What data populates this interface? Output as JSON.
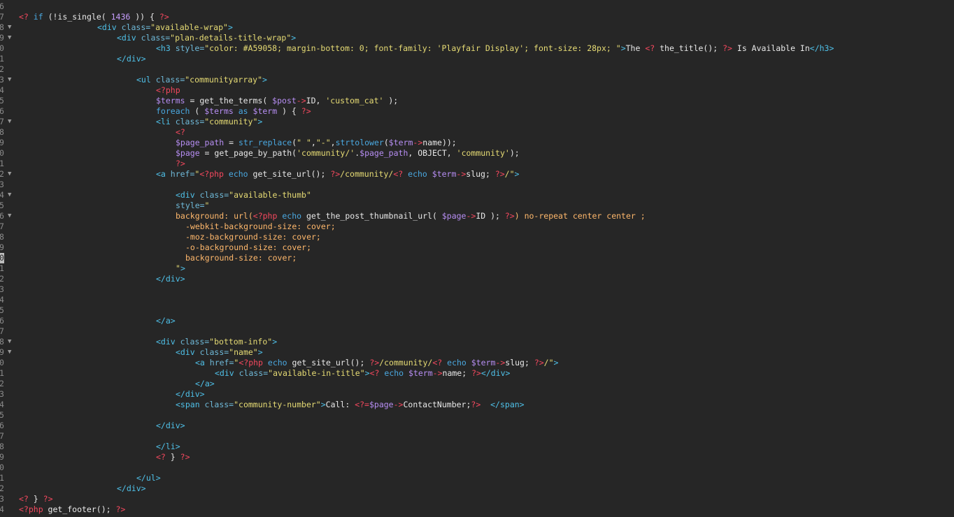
{
  "editor": {
    "active_line_index": 24,
    "lines": [
      {
        "n": "6",
        "fold": false,
        "indent": 0,
        "tokens": []
      },
      {
        "n": "7",
        "fold": false,
        "indent": 0,
        "tokens": [
          [
            "php",
            "<?"
          ],
          [
            "p",
            " "
          ],
          [
            "kw",
            "if"
          ],
          [
            "p",
            " (!is_single( "
          ],
          [
            "num",
            "1436"
          ],
          [
            "p",
            " )) { "
          ],
          [
            "php",
            "?>"
          ]
        ]
      },
      {
        "n": "8",
        "fold": true,
        "indent": 16,
        "tokens": [
          [
            "tag",
            "<div"
          ],
          [
            "attr",
            " class="
          ],
          [
            "str",
            "\"available-wrap\""
          ],
          [
            "tag",
            ">"
          ]
        ]
      },
      {
        "n": "9",
        "fold": true,
        "indent": 20,
        "tokens": [
          [
            "tag",
            "<div"
          ],
          [
            "attr",
            " class="
          ],
          [
            "str",
            "\"plan-details-title-wrap\""
          ],
          [
            "tag",
            ">"
          ]
        ]
      },
      {
        "n": "0",
        "fold": false,
        "indent": 28,
        "tokens": [
          [
            "tag",
            "<h3"
          ],
          [
            "attr",
            " style="
          ],
          [
            "str",
            "\"color: #A59058; margin-bottom: 0; font-family: 'Playfair Display'; font-size: 28px; \""
          ],
          [
            "tag",
            ">"
          ],
          [
            "p",
            "The "
          ],
          [
            "php",
            "<?"
          ],
          [
            "p",
            " the_title(); "
          ],
          [
            "php",
            "?>"
          ],
          [
            "p",
            " Is Available In"
          ],
          [
            "tag",
            "</h3>"
          ]
        ]
      },
      {
        "n": "1",
        "fold": false,
        "indent": 20,
        "tokens": [
          [
            "tag",
            "</div>"
          ]
        ]
      },
      {
        "n": "2",
        "fold": false,
        "indent": 0,
        "tokens": []
      },
      {
        "n": "3",
        "fold": true,
        "indent": 24,
        "tokens": [
          [
            "tag",
            "<ul"
          ],
          [
            "attr",
            " class="
          ],
          [
            "str",
            "\"communityarray\""
          ],
          [
            "tag",
            ">"
          ]
        ]
      },
      {
        "n": "4",
        "fold": false,
        "indent": 28,
        "tokens": [
          [
            "php",
            "<?php"
          ]
        ]
      },
      {
        "n": "5",
        "fold": false,
        "indent": 28,
        "tokens": [
          [
            "var",
            "$terms"
          ],
          [
            "p",
            " = get_the_terms( "
          ],
          [
            "var",
            "$post"
          ],
          [
            "php",
            "->"
          ],
          [
            "p",
            "ID, "
          ],
          [
            "str",
            "'custom_cat'"
          ],
          [
            "p",
            " );"
          ]
        ]
      },
      {
        "n": "6",
        "fold": false,
        "indent": 28,
        "tokens": [
          [
            "kw",
            "foreach"
          ],
          [
            "p",
            " ( "
          ],
          [
            "var",
            "$terms"
          ],
          [
            "p",
            " "
          ],
          [
            "kw",
            "as"
          ],
          [
            "p",
            " "
          ],
          [
            "var",
            "$term"
          ],
          [
            "p",
            " ) { "
          ],
          [
            "php",
            "?>"
          ]
        ]
      },
      {
        "n": "7",
        "fold": true,
        "indent": 28,
        "tokens": [
          [
            "tag",
            "<li"
          ],
          [
            "attr",
            " class="
          ],
          [
            "str",
            "\"community\""
          ],
          [
            "tag",
            ">"
          ]
        ]
      },
      {
        "n": "8",
        "fold": false,
        "indent": 32,
        "tokens": [
          [
            "php",
            "<?"
          ]
        ]
      },
      {
        "n": "9",
        "fold": false,
        "indent": 32,
        "tokens": [
          [
            "var",
            "$page_path"
          ],
          [
            "p",
            " = "
          ],
          [
            "kw",
            "str_replace"
          ],
          [
            "p",
            "("
          ],
          [
            "str",
            "\" \""
          ],
          [
            "p",
            ","
          ],
          [
            "str",
            "\"-\""
          ],
          [
            "p",
            ","
          ],
          [
            "kw",
            "strtolower"
          ],
          [
            "p",
            "("
          ],
          [
            "var",
            "$term"
          ],
          [
            "php",
            "->"
          ],
          [
            "p",
            "name));"
          ]
        ]
      },
      {
        "n": "0",
        "fold": false,
        "indent": 32,
        "tokens": [
          [
            "var",
            "$page"
          ],
          [
            "p",
            " = get_page_by_path("
          ],
          [
            "str",
            "'community/'"
          ],
          [
            "p",
            "."
          ],
          [
            "var",
            "$page_path"
          ],
          [
            "p",
            ", OBJECT, "
          ],
          [
            "str",
            "'community'"
          ],
          [
            "p",
            ");"
          ]
        ]
      },
      {
        "n": "1",
        "fold": false,
        "indent": 32,
        "tokens": [
          [
            "php",
            "?>"
          ]
        ]
      },
      {
        "n": "2",
        "fold": true,
        "indent": 28,
        "tokens": [
          [
            "tag",
            "<a"
          ],
          [
            "attr",
            " href="
          ],
          [
            "str",
            "\""
          ],
          [
            "php",
            "<?php"
          ],
          [
            "p",
            " "
          ],
          [
            "kw",
            "echo"
          ],
          [
            "p",
            " get_site_url(); "
          ],
          [
            "php",
            "?>"
          ],
          [
            "str",
            "/community/"
          ],
          [
            "php",
            "<?"
          ],
          [
            "p",
            " "
          ],
          [
            "kw",
            "echo"
          ],
          [
            "p",
            " "
          ],
          [
            "var",
            "$term"
          ],
          [
            "php",
            "->"
          ],
          [
            "p",
            "slug; "
          ],
          [
            "php",
            "?>"
          ],
          [
            "str",
            "/\""
          ],
          [
            "tag",
            ">"
          ]
        ]
      },
      {
        "n": "3",
        "fold": false,
        "indent": 0,
        "tokens": []
      },
      {
        "n": "4",
        "fold": true,
        "indent": 32,
        "tokens": [
          [
            "tag",
            "<div"
          ],
          [
            "attr",
            " class="
          ],
          [
            "str",
            "\"available-thumb\""
          ]
        ]
      },
      {
        "n": "5",
        "fold": false,
        "indent": 32,
        "tokens": [
          [
            "attr",
            "style="
          ],
          [
            "str",
            "\""
          ]
        ]
      },
      {
        "n": "6",
        "fold": true,
        "indent": 32,
        "tokens": [
          [
            "css",
            "background: url("
          ],
          [
            "php",
            "<?php"
          ],
          [
            "p",
            " "
          ],
          [
            "kw",
            "echo"
          ],
          [
            "p",
            " get_the_post_thumbnail_url( "
          ],
          [
            "var",
            "$page"
          ],
          [
            "php",
            "->"
          ],
          [
            "p",
            "ID ); "
          ],
          [
            "php",
            "?>"
          ],
          [
            "css",
            ") no-repeat center center ;"
          ]
        ]
      },
      {
        "n": "7",
        "fold": false,
        "indent": 34,
        "tokens": [
          [
            "css",
            "-webkit-background-size: cover;"
          ]
        ]
      },
      {
        "n": "8",
        "fold": false,
        "indent": 34,
        "tokens": [
          [
            "css",
            "-moz-background-size: cover;"
          ]
        ]
      },
      {
        "n": "9",
        "fold": false,
        "indent": 34,
        "tokens": [
          [
            "css",
            "-o-background-size: cover;"
          ]
        ]
      },
      {
        "n": "0",
        "fold": false,
        "indent": 34,
        "tokens": [
          [
            "css",
            "background-size: cover;"
          ]
        ]
      },
      {
        "n": "1",
        "fold": false,
        "indent": 32,
        "tokens": [
          [
            "str",
            "\""
          ],
          [
            "tag",
            ">"
          ]
        ]
      },
      {
        "n": "2",
        "fold": false,
        "indent": 28,
        "tokens": [
          [
            "tag",
            "</div>"
          ]
        ]
      },
      {
        "n": "3",
        "fold": false,
        "indent": 0,
        "tokens": []
      },
      {
        "n": "4",
        "fold": false,
        "indent": 0,
        "tokens": []
      },
      {
        "n": "5",
        "fold": false,
        "indent": 0,
        "tokens": []
      },
      {
        "n": "6",
        "fold": false,
        "indent": 28,
        "tokens": [
          [
            "tag",
            "</a>"
          ]
        ]
      },
      {
        "n": "7",
        "fold": false,
        "indent": 0,
        "tokens": []
      },
      {
        "n": "8",
        "fold": true,
        "indent": 28,
        "tokens": [
          [
            "tag",
            "<div"
          ],
          [
            "attr",
            " class="
          ],
          [
            "str",
            "\"bottom-info\""
          ],
          [
            "tag",
            ">"
          ]
        ]
      },
      {
        "n": "9",
        "fold": true,
        "indent": 32,
        "tokens": [
          [
            "tag",
            "<div"
          ],
          [
            "attr",
            " class="
          ],
          [
            "str",
            "\"name\""
          ],
          [
            "tag",
            ">"
          ]
        ]
      },
      {
        "n": "0",
        "fold": false,
        "indent": 36,
        "tokens": [
          [
            "tag",
            "<a"
          ],
          [
            "attr",
            " href="
          ],
          [
            "str",
            "\""
          ],
          [
            "php",
            "<?php"
          ],
          [
            "p",
            " "
          ],
          [
            "kw",
            "echo"
          ],
          [
            "p",
            " get_site_url(); "
          ],
          [
            "php",
            "?>"
          ],
          [
            "str",
            "/community/"
          ],
          [
            "php",
            "<?"
          ],
          [
            "p",
            " "
          ],
          [
            "kw",
            "echo"
          ],
          [
            "p",
            " "
          ],
          [
            "var",
            "$term"
          ],
          [
            "php",
            "->"
          ],
          [
            "p",
            "slug; "
          ],
          [
            "php",
            "?>"
          ],
          [
            "str",
            "/\""
          ],
          [
            "tag",
            ">"
          ]
        ]
      },
      {
        "n": "1",
        "fold": false,
        "indent": 40,
        "tokens": [
          [
            "tag",
            "<div"
          ],
          [
            "attr",
            " class="
          ],
          [
            "str",
            "\"available-in-title\""
          ],
          [
            "tag",
            ">"
          ],
          [
            "php",
            "<?"
          ],
          [
            "p",
            " "
          ],
          [
            "kw",
            "echo"
          ],
          [
            "p",
            " "
          ],
          [
            "var",
            "$term"
          ],
          [
            "php",
            "->"
          ],
          [
            "p",
            "name; "
          ],
          [
            "php",
            "?>"
          ],
          [
            "tag",
            "</div>"
          ]
        ]
      },
      {
        "n": "2",
        "fold": false,
        "indent": 36,
        "tokens": [
          [
            "tag",
            "</a>"
          ]
        ]
      },
      {
        "n": "3",
        "fold": false,
        "indent": 32,
        "tokens": [
          [
            "tag",
            "</div>"
          ]
        ]
      },
      {
        "n": "4",
        "fold": false,
        "indent": 32,
        "tokens": [
          [
            "tag",
            "<span"
          ],
          [
            "attr",
            " class="
          ],
          [
            "str",
            "\"community-number\""
          ],
          [
            "tag",
            ">"
          ],
          [
            "p",
            "Call: "
          ],
          [
            "php",
            "<?="
          ],
          [
            "var",
            "$page"
          ],
          [
            "php",
            "->"
          ],
          [
            "p",
            "ContactNumber;"
          ],
          [
            "php",
            "?>"
          ],
          [
            "p",
            "  "
          ],
          [
            "tag",
            "</span>"
          ]
        ]
      },
      {
        "n": "5",
        "fold": false,
        "indent": 0,
        "tokens": []
      },
      {
        "n": "6",
        "fold": false,
        "indent": 28,
        "tokens": [
          [
            "tag",
            "</div>"
          ]
        ]
      },
      {
        "n": "7",
        "fold": false,
        "indent": 0,
        "tokens": []
      },
      {
        "n": "8",
        "fold": false,
        "indent": 28,
        "tokens": [
          [
            "tag",
            "</li>"
          ]
        ]
      },
      {
        "n": "9",
        "fold": false,
        "indent": 28,
        "tokens": [
          [
            "php",
            "<?"
          ],
          [
            "p",
            " } "
          ],
          [
            "php",
            "?>"
          ]
        ]
      },
      {
        "n": "0",
        "fold": false,
        "indent": 0,
        "tokens": []
      },
      {
        "n": "1",
        "fold": false,
        "indent": 24,
        "tokens": [
          [
            "tag",
            "</ul>"
          ]
        ]
      },
      {
        "n": "2",
        "fold": false,
        "indent": 20,
        "tokens": [
          [
            "tag",
            "</div>"
          ]
        ]
      },
      {
        "n": "3",
        "fold": false,
        "indent": 0,
        "tokens": [
          [
            "php",
            "<?"
          ],
          [
            "p",
            " } "
          ],
          [
            "php",
            "?>"
          ]
        ]
      },
      {
        "n": "4",
        "fold": false,
        "indent": 0,
        "tokens": [
          [
            "php",
            "<?php"
          ],
          [
            "p",
            " get_footer(); "
          ],
          [
            "php",
            "?>"
          ]
        ]
      }
    ]
  }
}
